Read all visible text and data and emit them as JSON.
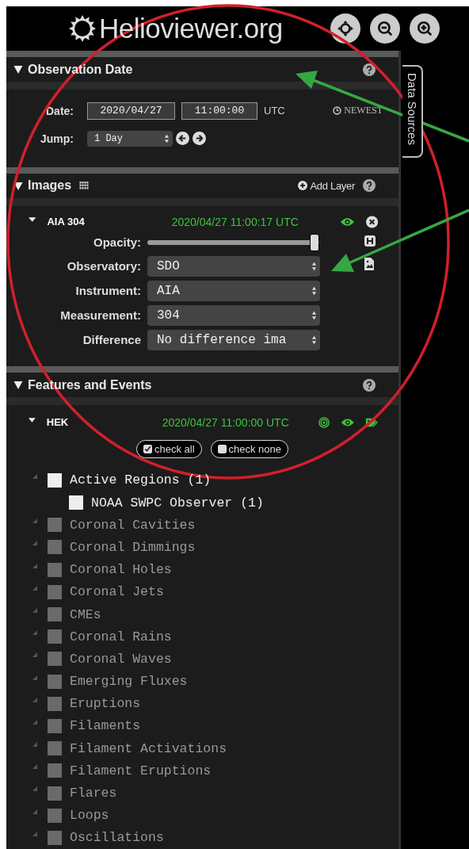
{
  "header": {
    "logo": "Helioviewer.org"
  },
  "side_tab": {
    "label": "Data Sources"
  },
  "observation_date": {
    "title": "Observation Date",
    "date_label": "Date:",
    "date": "2020/04/27",
    "time": "11:00:00",
    "timezone": "UTC",
    "newest": "NEWEST",
    "jump_label": "Jump:",
    "jump": "1 Day"
  },
  "images": {
    "title": "Images",
    "add_layer": "Add Layer",
    "layer": {
      "name": "AIA 304",
      "timestamp": "2020/04/27 11:00:17 UTC",
      "visible": true,
      "rows": [
        {
          "kind": "slider",
          "label": "Opacity:",
          "level": 0.97
        },
        {
          "kind": "select",
          "label": "Observatory:",
          "value": "SDO"
        },
        {
          "kind": "select",
          "label": "Instrument:",
          "value": "AIA"
        },
        {
          "kind": "select",
          "label": "Measurement:",
          "value": "304"
        },
        {
          "kind": "select",
          "label": "Difference",
          "value": "No difference ima"
        }
      ]
    }
  },
  "features": {
    "title": "Features and Events",
    "source": {
      "name": "HEK",
      "timestamp": "2020/04/27 11:00:00 UTC",
      "visible": true
    },
    "check_all": "check all",
    "check_none": "check none",
    "tree": [
      {
        "label": "Active Regions (1)",
        "disabled": false,
        "checked": false,
        "children": [
          {
            "label": "NOAA SWPC Observer (1)",
            "disabled": false,
            "checked": false
          }
        ]
      },
      {
        "label": "Coronal Cavities",
        "disabled": true,
        "checked": false
      },
      {
        "label": "Coronal Dimmings",
        "disabled": true,
        "checked": false
      },
      {
        "label": "Coronal Holes",
        "disabled": true,
        "checked": false
      },
      {
        "label": "Coronal Jets",
        "disabled": true,
        "checked": false
      },
      {
        "label": "CMEs",
        "disabled": true,
        "checked": false
      },
      {
        "label": "Coronal Rains",
        "disabled": true,
        "checked": false
      },
      {
        "label": "Coronal Waves",
        "disabled": true,
        "checked": false
      },
      {
        "label": "Emerging Fluxes",
        "disabled": true,
        "checked": false
      },
      {
        "label": "Eruptions",
        "disabled": true,
        "checked": false
      },
      {
        "label": "Filaments",
        "disabled": true,
        "checked": false
      },
      {
        "label": "Filament Activations",
        "disabled": true,
        "checked": false
      },
      {
        "label": "Filament Eruptions",
        "disabled": true,
        "checked": false
      },
      {
        "label": "Flares",
        "disabled": true,
        "checked": false
      },
      {
        "label": "Loops",
        "disabled": true,
        "checked": false
      },
      {
        "label": "Oscillations",
        "disabled": true,
        "checked": false
      }
    ]
  }
}
